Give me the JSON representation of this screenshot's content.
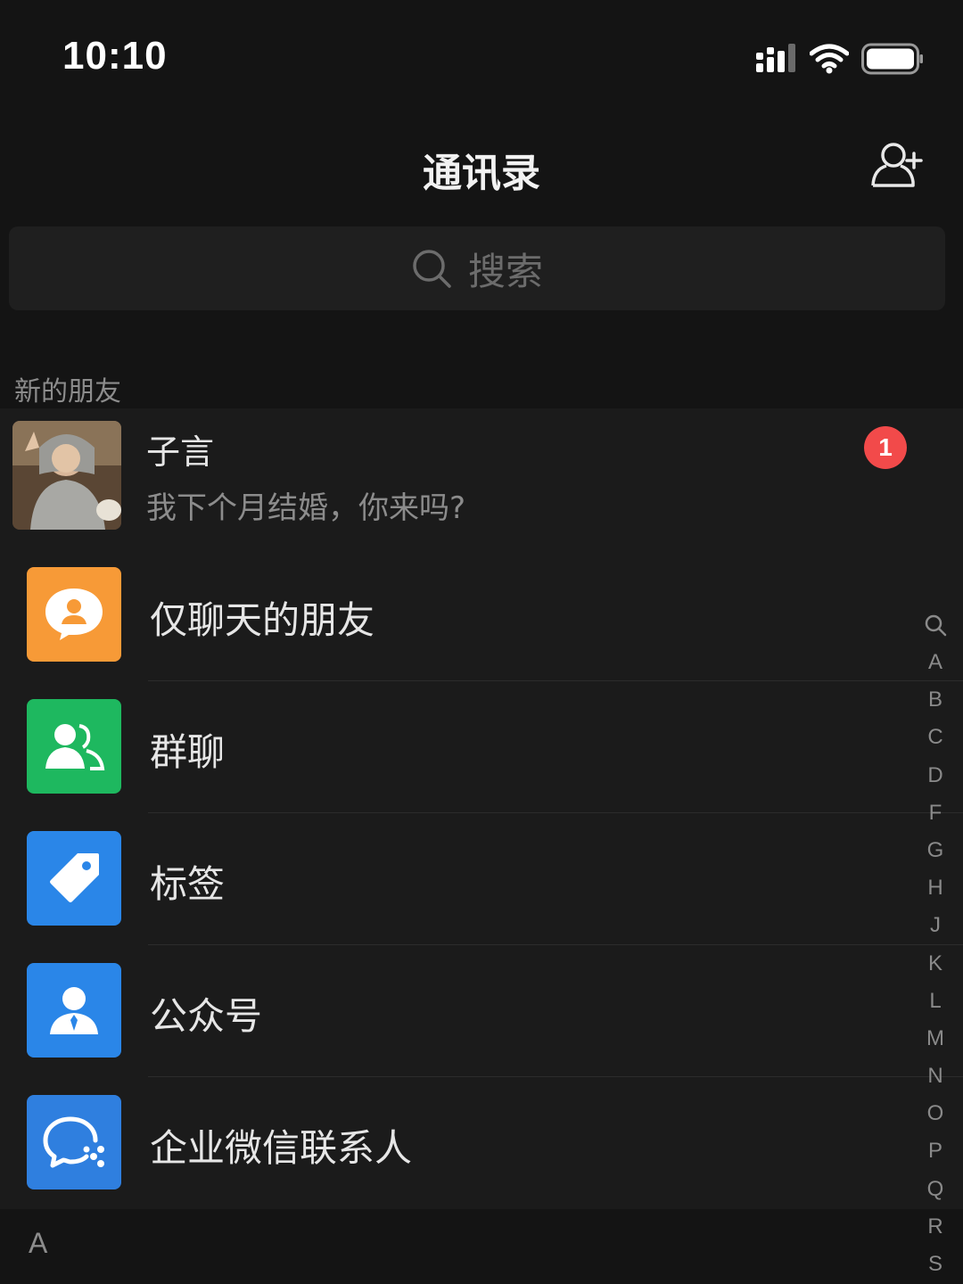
{
  "status_bar": {
    "time": "10:10"
  },
  "header": {
    "title": "通讯录"
  },
  "search": {
    "placeholder": "搜索"
  },
  "new_friends": {
    "section_label": "新的朋友",
    "item": {
      "name": "子言",
      "message": "我下个月结婚，你来吗?",
      "badge": "1"
    }
  },
  "features": [
    {
      "label": "仅聊天的朋友",
      "icon": "chat-only-friends-icon",
      "color": "#f79a37"
    },
    {
      "label": "群聊",
      "icon": "group-chat-icon",
      "color": "#1eb85f"
    },
    {
      "label": "标签",
      "icon": "tag-icon",
      "color": "#2a86e8"
    },
    {
      "label": "公众号",
      "icon": "official-account-icon",
      "color": "#2a86e8"
    },
    {
      "label": "企业微信联系人",
      "icon": "wecom-contacts-icon",
      "color": "#2f7fdf"
    }
  ],
  "section_a": {
    "label": "A"
  },
  "index_bar": [
    "A",
    "B",
    "C",
    "D",
    "F",
    "G",
    "H",
    "J",
    "K",
    "L",
    "M",
    "N",
    "O",
    "P",
    "Q",
    "R",
    "S"
  ]
}
